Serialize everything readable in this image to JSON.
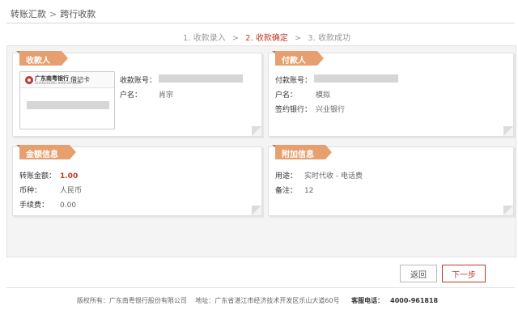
{
  "breadcrumb": {
    "parent": "转账汇款",
    "separator": ">",
    "current": "跨行收款"
  },
  "steps": [
    {
      "label": "1. 收款录入",
      "active": false
    },
    {
      "label": "2. 收款确定",
      "active": true
    },
    {
      "label": "3. 收款成功",
      "active": false
    }
  ],
  "steps_arrow": ">",
  "payee": {
    "title": "收款人",
    "bank_card": {
      "bank_name": "广东南粤银行",
      "bank_name_en": "GUANGDONG NANYUE BANK",
      "card_type": "借记卡"
    },
    "account_label": "收款账号：",
    "name_label": "户名：",
    "name_value": "肖宗"
  },
  "payer": {
    "title": "付款人",
    "account_label": "付款账号：",
    "name_label": "户名：",
    "name_value": "模拟",
    "bank_label": "签约银行：",
    "bank_value": "兴业银行"
  },
  "amount_info": {
    "title": "金额信息",
    "amount_label": "转账金额：",
    "amount_value": "1.00",
    "currency_label": "币种：",
    "currency_value": "人民币",
    "fee_label": "手续费：",
    "fee_value": "0.00"
  },
  "extra_info": {
    "title": "附加信息",
    "purpose_label": "用途：",
    "purpose_value": "实时代收 - 电话费",
    "remark_label": "备注：",
    "remark_value": "12"
  },
  "buttons": {
    "back": "返回",
    "next": "下一步"
  },
  "footer": {
    "copyright": "版权所有：广东南粤银行股份有限公司",
    "address": "地址：广东省湛江市经济技术开发区乐山大道60号",
    "hotline_label": "客服电话：",
    "hotline_value": "4000-961818"
  },
  "colors": {
    "accent": "#c0392b",
    "tab": "#e6a06f",
    "panel_bg": "#f4f4f4"
  }
}
